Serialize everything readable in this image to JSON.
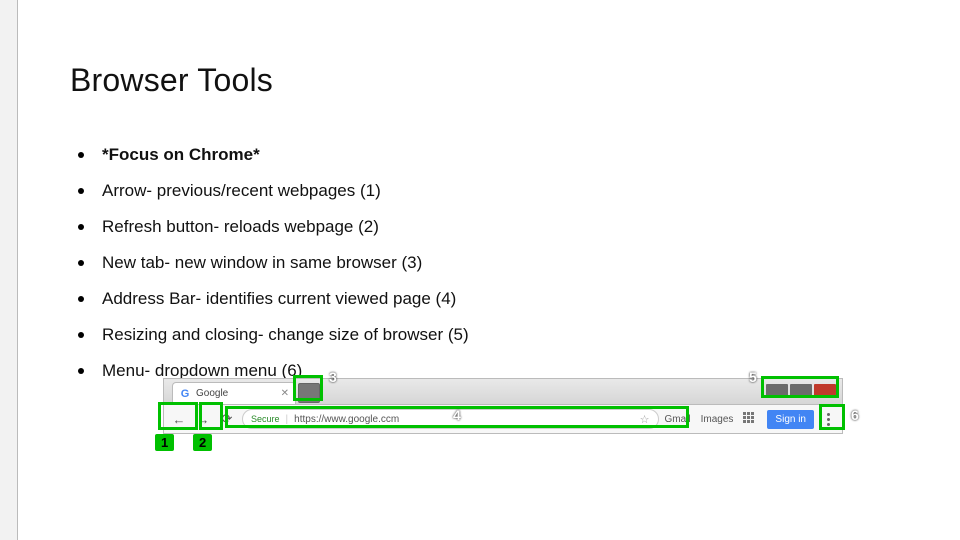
{
  "title": "Browser Tools",
  "bullets": [
    {
      "text": "*Focus on Chrome*",
      "bold": true
    },
    {
      "text": "Arrow- previous/recent webpages (1)",
      "bold": false
    },
    {
      "text": "Refresh button- reloads webpage (2)",
      "bold": false
    },
    {
      "text": "New tab- new window in same browser (3)",
      "bold": false
    },
    {
      "text": "Address Bar- identifies current viewed page (4)",
      "bold": false
    },
    {
      "text": "Resizing and closing- change size of browser (5)",
      "bold": false
    },
    {
      "text": "Menu- dropdown menu (6)",
      "bold": false
    }
  ],
  "browser": {
    "tab_label": "Google",
    "secure_label": "Secure",
    "url": "https://www.google.ccm",
    "links": {
      "gmail": "Gmail",
      "images": "Images"
    },
    "signin_label": "Sign in"
  },
  "annotations": {
    "n1": "1",
    "n2": "2",
    "n3": "3",
    "n4": "4",
    "n5": "5",
    "n6": "6"
  }
}
